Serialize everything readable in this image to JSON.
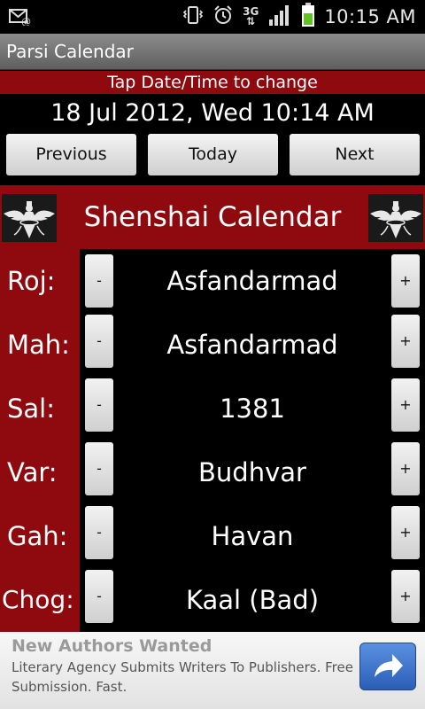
{
  "status_bar": {
    "network": "3G",
    "time": "10:15 AM"
  },
  "app": {
    "title": "Parsi Calendar"
  },
  "banner": "Tap Date/Time to change",
  "datetime": "18 Jul 2012, Wed  10:14 AM",
  "nav": {
    "previous": "Previous",
    "today": "Today",
    "next": "Next"
  },
  "calendar": {
    "title": "Shenshai Calendar",
    "rows": [
      {
        "label": "Roj:",
        "value": "Asfandarmad"
      },
      {
        "label": "Mah:",
        "value": "Asfandarmad"
      },
      {
        "label": "Sal:",
        "value": "1381"
      },
      {
        "label": "Var:",
        "value": "Budhvar"
      },
      {
        "label": "Gah:",
        "value": "Havan"
      },
      {
        "label": "Chog:",
        "value": "Kaal (Bad)"
      }
    ],
    "minus": "-",
    "plus": "+"
  },
  "ad": {
    "title": "New Authors Wanted",
    "body": "Literary Agency Submits Writers To Publishers. Free Submission. Fast."
  },
  "colors": {
    "accent_red": "#8e0a0e",
    "ad_button": "#3b74cf"
  }
}
